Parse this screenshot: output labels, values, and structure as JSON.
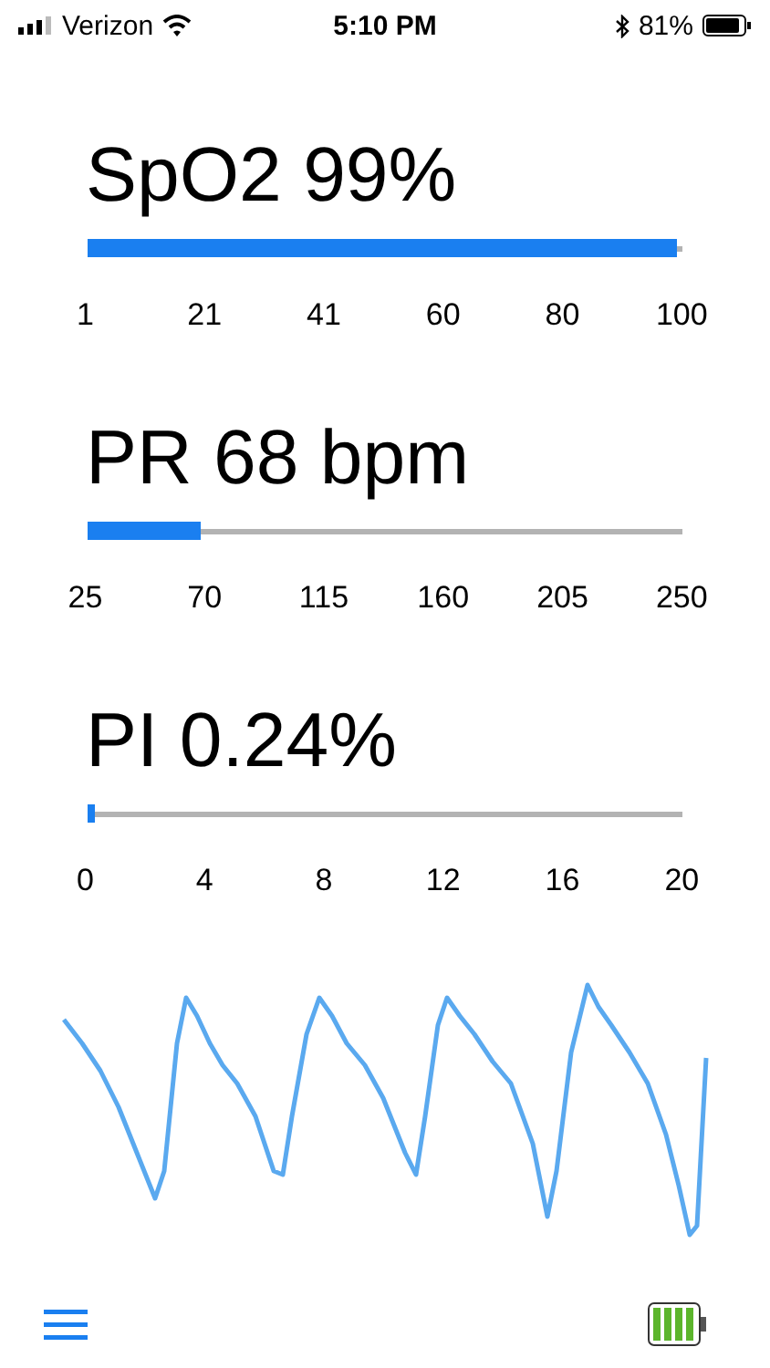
{
  "status_bar": {
    "carrier": "Verizon",
    "time": "5:10 PM",
    "battery": "81%"
  },
  "gauges": [
    {
      "title": "SpO2 99%",
      "level": 0.99,
      "ticks": [
        "1",
        "21",
        "41",
        "60",
        "80",
        "100"
      ]
    },
    {
      "title": "PR 68 bpm",
      "level": 0.19,
      "ticks": [
        "25",
        "70",
        "115",
        "160",
        "205",
        "250"
      ]
    },
    {
      "title": "PI 0.24%",
      "level": 0.012,
      "ticks": [
        "0",
        "4",
        "8",
        "12",
        "16",
        "20"
      ]
    }
  ]
}
